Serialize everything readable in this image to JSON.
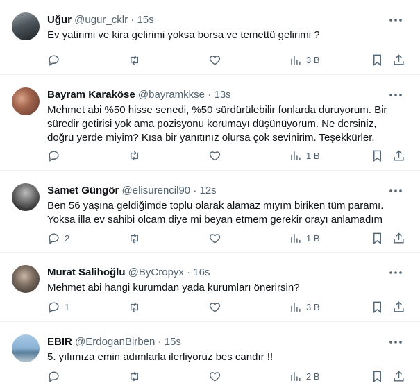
{
  "tweets": [
    {
      "name": "Uğur",
      "handle": "@ugur_cklr",
      "time": "15s",
      "text": "Ev yatirimi ve kira gelirimi yoksa borsa ve temettü gelirimi ?",
      "replies": "",
      "views": "3 B"
    },
    {
      "name": "Bayram Karaköse",
      "handle": "@bayramkkse",
      "time": "13s",
      "text": "Mehmet abi %50 hisse senedi, %50 sürdürülebilir fonlarda duruyorum. Bir\nsüredir getirisi yok ama pozisyonu korumayı düşünüyorum. Ne dersiniz,\ndoğru yerde miyim? Kısa bir yanıtınız olursa çok sevinirim. Teşekkürler.",
      "replies": "",
      "views": "1 B"
    },
    {
      "name": "Samet Güngör",
      "handle": "@elisurencil90",
      "time": "12s",
      "text": "Ben 56 yaşına geldiğimde toplu olarak alamaz mıyım biriken tüm paramı.\nYoksa illa ev sahibi olcam diye mi beyan etmem gerekir orayı anlamadım",
      "replies": "2",
      "views": "1 B"
    },
    {
      "name": "Murat Salihoğlu",
      "handle": "@ByCropyx",
      "time": "16s",
      "text": "Mehmet abi hangi kurumdan yada kurumları önerirsin?",
      "replies": "1",
      "views": "3 B"
    },
    {
      "name": "EBIR",
      "handle": "@ErdoganBirben",
      "time": "15s",
      "text": "5. yılımıza emin adımlarla ilerliyoruz bes candır !!",
      "replies": "",
      "views": "2 B"
    }
  ],
  "separator": "·"
}
